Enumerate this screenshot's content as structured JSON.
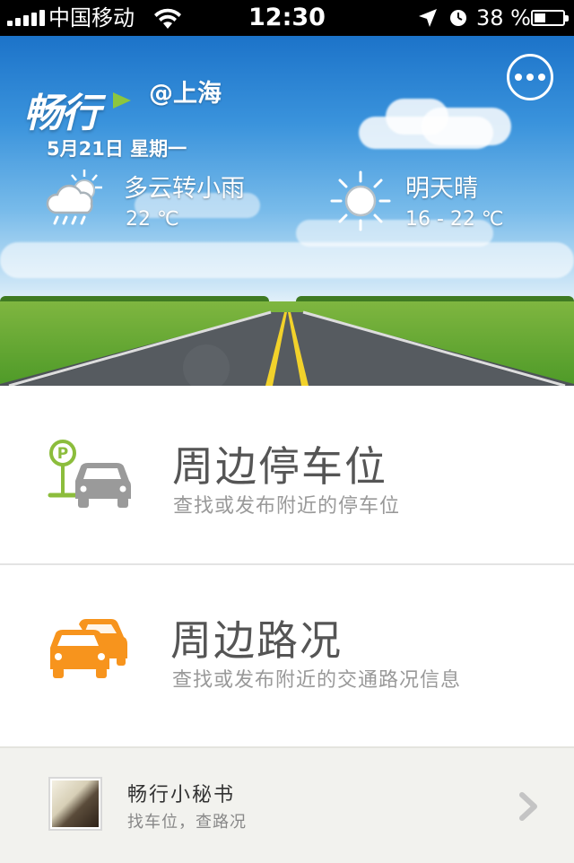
{
  "status_bar": {
    "carrier": "中国移动",
    "time": "12:30",
    "battery_percent": "38 %",
    "battery_level": 0.38,
    "signal_bars": 5
  },
  "header": {
    "app_name": "畅行",
    "city": "@上海",
    "date": "5月21日 星期一",
    "today": {
      "condition": "多云转小雨",
      "temperature": "22 ℃",
      "icon": "cloud-rain-sun-icon"
    },
    "tomorrow": {
      "condition": "明天晴",
      "temperature": "16 - 22 ℃",
      "icon": "sun-icon"
    }
  },
  "menu": {
    "parking": {
      "title": "周边停车位",
      "subtitle": "查找或发布附近的停车位",
      "icon": "parking-car-icon",
      "colors": {
        "sign": "#8cbd3c",
        "car": "#9a9a9a"
      }
    },
    "traffic": {
      "title": "周边路况",
      "subtitle": "查找或发布附近的交通路况信息",
      "icon": "traffic-cars-icon",
      "colors": {
        "car": "#f7941d"
      }
    }
  },
  "footer": {
    "name": "畅行小秘书",
    "description": "找车位，查路况",
    "icon": "chevron-right-icon"
  }
}
